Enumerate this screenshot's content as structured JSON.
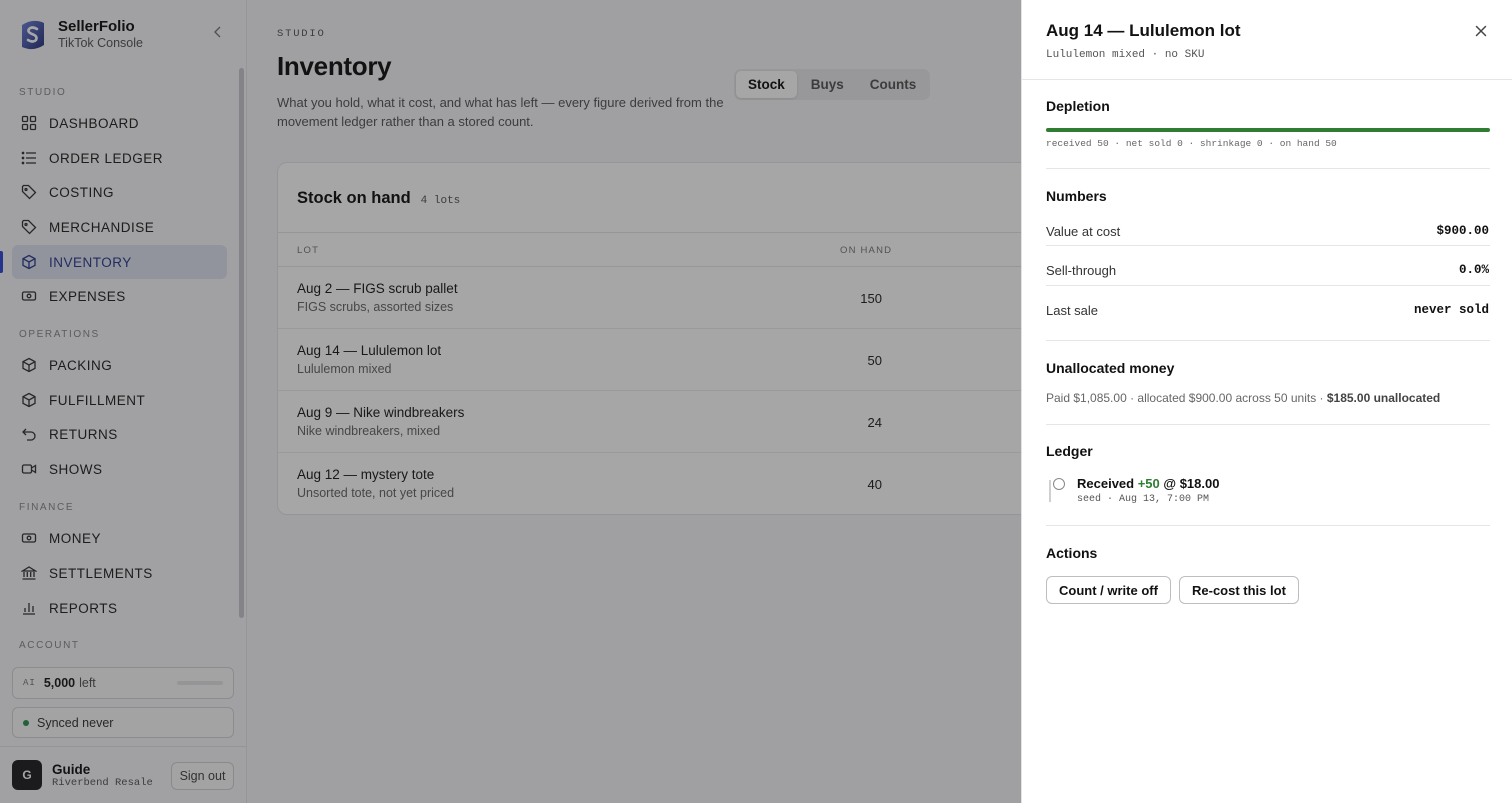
{
  "brand": {
    "name": "SellerFolio",
    "subtitle": "TikTok Console"
  },
  "sidebar": {
    "sections": [
      "STUDIO",
      "OPERATIONS",
      "FINANCE",
      "ACCOUNT"
    ],
    "items": [
      {
        "label": "DASHBOARD",
        "icon": "grid-icon"
      },
      {
        "label": "ORDER LEDGER",
        "icon": "list-icon"
      },
      {
        "label": "COSTING",
        "icon": "tag-icon"
      },
      {
        "label": "MERCHANDISE",
        "icon": "tag-icon"
      },
      {
        "label": "INVENTORY",
        "icon": "box-icon",
        "active": true
      },
      {
        "label": "EXPENSES",
        "icon": "cash-icon"
      },
      {
        "label": "PACKING",
        "icon": "box-icon"
      },
      {
        "label": "FULFILLMENT",
        "icon": "box-icon"
      },
      {
        "label": "RETURNS",
        "icon": "return-icon"
      },
      {
        "label": "SHOWS",
        "icon": "video-icon"
      },
      {
        "label": "MONEY",
        "icon": "cash-icon"
      },
      {
        "label": "SETTLEMENTS",
        "icon": "bank-icon"
      },
      {
        "label": "REPORTS",
        "icon": "bar-chart-icon"
      }
    ],
    "ai": {
      "tag": "AI",
      "count": "5,000",
      "suffix": "left"
    },
    "sync": "Synced never",
    "user": {
      "initial": "G",
      "name": "Guide",
      "org": "Riverbend Resale",
      "signout": "Sign out"
    }
  },
  "page": {
    "eyebrow": "STUDIO",
    "title": "Inventory",
    "subtitle": "What you hold, what it cost, and what has left — every figure derived from the movement ledger rather than a stored count.",
    "tabs": [
      "Stock",
      "Buys",
      "Counts"
    ],
    "active_tab": "Stock"
  },
  "stock": {
    "title": "Stock on hand",
    "count": "4 lots",
    "headers": {
      "lot": "LOT",
      "on_hand": "ON HAND"
    },
    "rows": [
      {
        "name": "Aug 2 — FIGS scrub pallet",
        "desc": "FIGS scrubs, assorted sizes",
        "qty": "150"
      },
      {
        "name": "Aug 14 — Lululemon lot",
        "desc": "Lululemon mixed",
        "qty": "50"
      },
      {
        "name": "Aug 9 — Nike windbreakers",
        "desc": "Nike windbreakers, mixed",
        "qty": "24"
      },
      {
        "name": "Aug 12 — mystery tote",
        "desc": "Unsorted tote, not yet priced",
        "qty": "40"
      }
    ]
  },
  "drawer": {
    "title": "Aug 14 — Lululemon lot",
    "subtitle": "Lululemon mixed · no SKU",
    "depletion": {
      "heading": "Depletion",
      "on_hand_fraction": 1.0,
      "note": "received 50 · net sold 0 · shrinkage 0 · on hand 50"
    },
    "numbers": {
      "heading": "Numbers",
      "rows": [
        {
          "label": "Value at cost",
          "value": "$900.00"
        },
        {
          "label": "Sell-through",
          "value": "0.0%"
        },
        {
          "label": "Last sale",
          "value": "never sold"
        }
      ]
    },
    "unallocated": {
      "heading": "Unallocated money",
      "text": "Paid $1,085.00 · allocated $900.00 across 50 units · ",
      "bold": "$185.00 unallocated"
    },
    "ledger": {
      "heading": "Ledger",
      "entry": {
        "type": "Received",
        "qty": "+50",
        "price": "@ $18.00",
        "meta": "seed · Aug 13, 7:00 PM"
      }
    },
    "actions": {
      "heading": "Actions",
      "count_label": "Count / write off",
      "recost_label": "Re-cost this lot"
    }
  },
  "colors": {
    "accent": "#2f48d4",
    "success": "#2e7d32"
  }
}
